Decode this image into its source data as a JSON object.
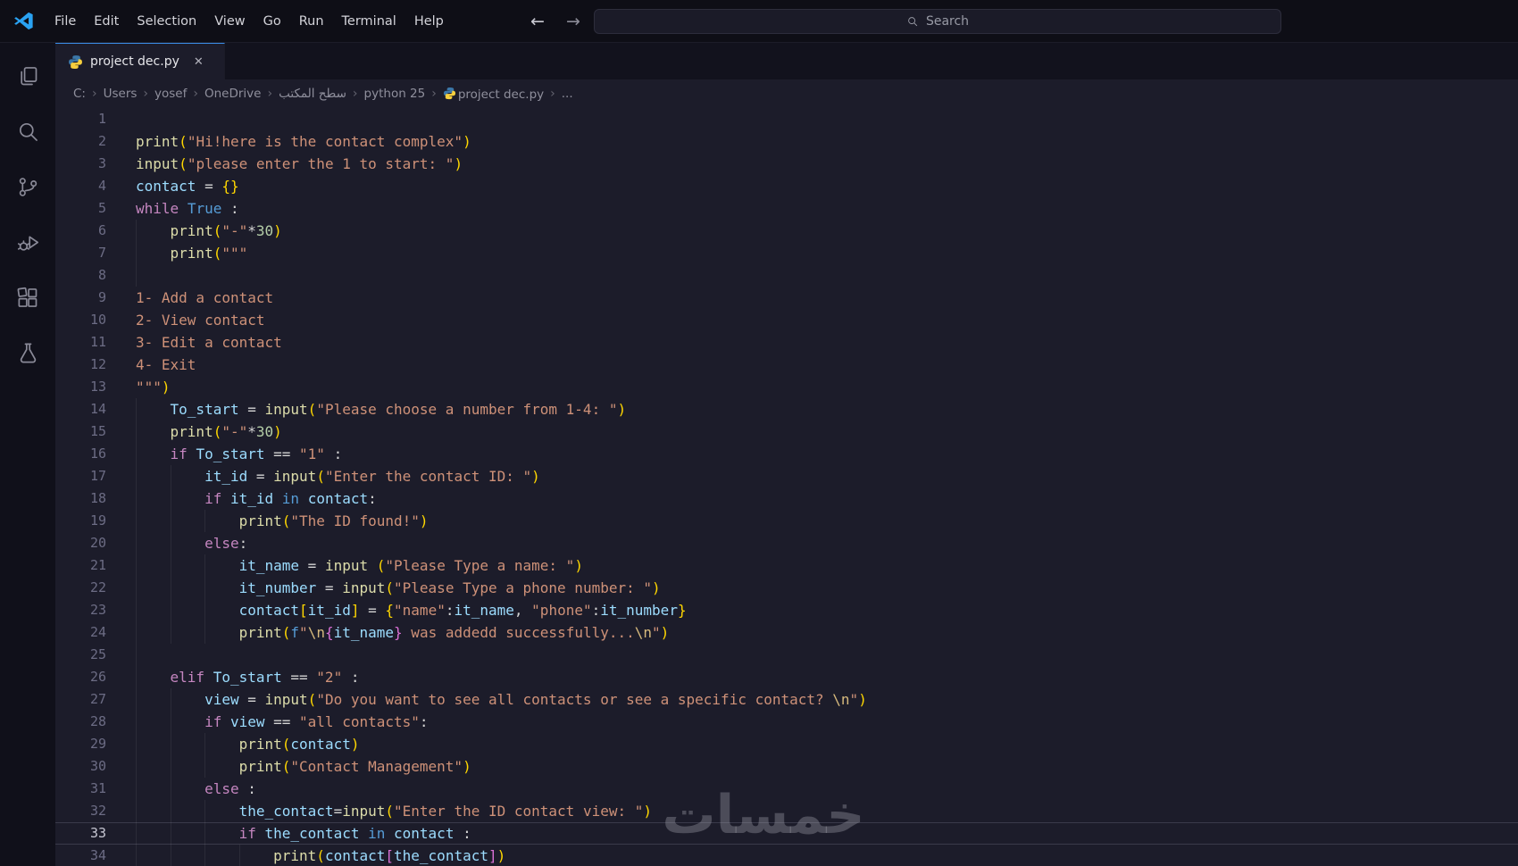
{
  "title_bar": {
    "menus": [
      "File",
      "Edit",
      "Selection",
      "View",
      "Go",
      "Run",
      "Terminal",
      "Help"
    ],
    "search_placeholder": "Search"
  },
  "icons": {
    "back": "←",
    "forward": "→",
    "close": "✕",
    "chevron": "›"
  },
  "colors": {
    "accent": "#3b8eea",
    "python_blue": "#3b77a8",
    "python_yellow": "#f7cf3e",
    "vscode_logo_blue": "#2aa2f2"
  },
  "activity_bar": {
    "items": [
      "explorer",
      "search",
      "source-control",
      "run-and-debug",
      "extensions",
      "testing"
    ]
  },
  "tab": {
    "label": "project dec.py"
  },
  "breadcrumb": {
    "items": [
      {
        "label": "C:"
      },
      {
        "label": "Users"
      },
      {
        "label": "yosef"
      },
      {
        "label": "OneDrive"
      },
      {
        "label": "سطح المكتب"
      },
      {
        "label": "python 25"
      },
      {
        "label": "project dec.py",
        "icon": "python"
      },
      {
        "label": "..."
      }
    ]
  },
  "watermark": {
    "text": "خمسات"
  },
  "syntax_colors": {
    "fn": "#dcdcaa",
    "kw": "#c586c0",
    "kwb": "#569cd6",
    "var": "#9cdcfe",
    "str": "#ce9178",
    "num": "#b5cea8",
    "op": "#d4d4d4",
    "b1": "#ffd700",
    "b2": "#da70d6",
    "esc": "#d7ba7d"
  },
  "editor": {
    "current_line": 33,
    "lines": [
      {
        "n": 1,
        "g": 0,
        "t": []
      },
      {
        "n": 2,
        "g": 0,
        "t": [
          [
            "print",
            "fn"
          ],
          [
            "(",
            "b1"
          ],
          [
            "\"Hi!here is the contact complex\"",
            "str"
          ],
          [
            ")",
            "b1"
          ]
        ]
      },
      {
        "n": 3,
        "g": 0,
        "t": [
          [
            "input",
            "fn"
          ],
          [
            "(",
            "b1"
          ],
          [
            "\"please enter the 1 to start: \"",
            "str"
          ],
          [
            ")",
            "b1"
          ]
        ]
      },
      {
        "n": 4,
        "g": 0,
        "t": [
          [
            "contact",
            "var"
          ],
          [
            " = ",
            "op"
          ],
          [
            "{}",
            "b1"
          ]
        ]
      },
      {
        "n": 5,
        "g": 0,
        "t": [
          [
            "while",
            "kw"
          ],
          [
            " ",
            "op"
          ],
          [
            "True",
            "kwb"
          ],
          [
            " :",
            "op"
          ]
        ]
      },
      {
        "n": 6,
        "g": 1,
        "t": [
          [
            "    ",
            "op"
          ],
          [
            "print",
            "fn"
          ],
          [
            "(",
            "b1"
          ],
          [
            "\"-\"",
            "str"
          ],
          [
            "*",
            "op"
          ],
          [
            "30",
            "num"
          ],
          [
            ")",
            "b1"
          ]
        ]
      },
      {
        "n": 7,
        "g": 1,
        "t": [
          [
            "    ",
            "op"
          ],
          [
            "print",
            "fn"
          ],
          [
            "(",
            "b1"
          ],
          [
            "\"\"\"",
            "str"
          ]
        ]
      },
      {
        "n": 8,
        "g": 1,
        "t": []
      },
      {
        "n": 9,
        "g": 0,
        "t": [
          [
            "1- Add a contact",
            "str"
          ]
        ]
      },
      {
        "n": 10,
        "g": 0,
        "t": [
          [
            "2- View contact",
            "str"
          ]
        ]
      },
      {
        "n": 11,
        "g": 0,
        "t": [
          [
            "3- Edit a contact",
            "str"
          ]
        ]
      },
      {
        "n": 12,
        "g": 0,
        "t": [
          [
            "4- Exit",
            "str"
          ]
        ]
      },
      {
        "n": 13,
        "g": 0,
        "t": [
          [
            "\"\"\"",
            "str"
          ],
          [
            ")",
            "b1"
          ]
        ]
      },
      {
        "n": 14,
        "g": 1,
        "t": [
          [
            "    ",
            "op"
          ],
          [
            "To_start",
            "var"
          ],
          [
            " = ",
            "op"
          ],
          [
            "input",
            "fn"
          ],
          [
            "(",
            "b1"
          ],
          [
            "\"Please choose a number from 1-4: \"",
            "str"
          ],
          [
            ")",
            "b1"
          ]
        ]
      },
      {
        "n": 15,
        "g": 1,
        "t": [
          [
            "    ",
            "op"
          ],
          [
            "print",
            "fn"
          ],
          [
            "(",
            "b1"
          ],
          [
            "\"-\"",
            "str"
          ],
          [
            "*",
            "op"
          ],
          [
            "30",
            "num"
          ],
          [
            ")",
            "b1"
          ]
        ]
      },
      {
        "n": 16,
        "g": 1,
        "t": [
          [
            "    ",
            "op"
          ],
          [
            "if",
            "kw"
          ],
          [
            " ",
            "op"
          ],
          [
            "To_start",
            "var"
          ],
          [
            " == ",
            "op"
          ],
          [
            "\"1\"",
            "str"
          ],
          [
            " :",
            "op"
          ]
        ]
      },
      {
        "n": 17,
        "g": 2,
        "t": [
          [
            "        ",
            "op"
          ],
          [
            "it_id",
            "var"
          ],
          [
            " = ",
            "op"
          ],
          [
            "input",
            "fn"
          ],
          [
            "(",
            "b1"
          ],
          [
            "\"Enter the contact ID: \"",
            "str"
          ],
          [
            ")",
            "b1"
          ]
        ]
      },
      {
        "n": 18,
        "g": 2,
        "t": [
          [
            "        ",
            "op"
          ],
          [
            "if",
            "kw"
          ],
          [
            " ",
            "op"
          ],
          [
            "it_id",
            "var"
          ],
          [
            " ",
            "op"
          ],
          [
            "in",
            "kwb"
          ],
          [
            " ",
            "op"
          ],
          [
            "contact",
            "var"
          ],
          [
            ":",
            "op"
          ]
        ]
      },
      {
        "n": 19,
        "g": 3,
        "t": [
          [
            "            ",
            "op"
          ],
          [
            "print",
            "fn"
          ],
          [
            "(",
            "b1"
          ],
          [
            "\"The ID found!\"",
            "str"
          ],
          [
            ")",
            "b1"
          ]
        ]
      },
      {
        "n": 20,
        "g": 2,
        "t": [
          [
            "        ",
            "op"
          ],
          [
            "else",
            "kw"
          ],
          [
            ":",
            "op"
          ]
        ]
      },
      {
        "n": 21,
        "g": 3,
        "t": [
          [
            "            ",
            "op"
          ],
          [
            "it_name",
            "var"
          ],
          [
            " = ",
            "op"
          ],
          [
            "input",
            "fn"
          ],
          [
            " ",
            "op"
          ],
          [
            "(",
            "b1"
          ],
          [
            "\"Please Type a name: \"",
            "str"
          ],
          [
            ")",
            "b1"
          ]
        ]
      },
      {
        "n": 22,
        "g": 3,
        "t": [
          [
            "            ",
            "op"
          ],
          [
            "it_number",
            "var"
          ],
          [
            " = ",
            "op"
          ],
          [
            "input",
            "fn"
          ],
          [
            "(",
            "b1"
          ],
          [
            "\"Please Type a phone number: \"",
            "str"
          ],
          [
            ")",
            "b1"
          ]
        ]
      },
      {
        "n": 23,
        "g": 3,
        "t": [
          [
            "            ",
            "op"
          ],
          [
            "contact",
            "var"
          ],
          [
            "[",
            "b1"
          ],
          [
            "it_id",
            "var"
          ],
          [
            "]",
            "b1"
          ],
          [
            " = ",
            "op"
          ],
          [
            "{",
            "b1"
          ],
          [
            "\"name\"",
            "str"
          ],
          [
            ":",
            "op"
          ],
          [
            "it_name",
            "var"
          ],
          [
            ", ",
            "op"
          ],
          [
            "\"phone\"",
            "str"
          ],
          [
            ":",
            "op"
          ],
          [
            "it_number",
            "var"
          ],
          [
            "}",
            "b1"
          ]
        ]
      },
      {
        "n": 24,
        "g": 3,
        "t": [
          [
            "            ",
            "op"
          ],
          [
            "print",
            "fn"
          ],
          [
            "(",
            "b1"
          ],
          [
            "f",
            "kwb"
          ],
          [
            "\"",
            "str"
          ],
          [
            "\\n",
            "esc"
          ],
          [
            "{",
            "b2"
          ],
          [
            "it_name",
            "var"
          ],
          [
            "}",
            "b2"
          ],
          [
            " was addedd successfully...",
            "str"
          ],
          [
            "\\n",
            "esc"
          ],
          [
            "\"",
            "str"
          ],
          [
            ")",
            "b1"
          ]
        ]
      },
      {
        "n": 25,
        "g": 1,
        "t": []
      },
      {
        "n": 26,
        "g": 1,
        "t": [
          [
            "    ",
            "op"
          ],
          [
            "elif",
            "kw"
          ],
          [
            " ",
            "op"
          ],
          [
            "To_start",
            "var"
          ],
          [
            " == ",
            "op"
          ],
          [
            "\"2\"",
            "str"
          ],
          [
            " :",
            "op"
          ]
        ]
      },
      {
        "n": 27,
        "g": 2,
        "t": [
          [
            "        ",
            "op"
          ],
          [
            "view",
            "var"
          ],
          [
            " = ",
            "op"
          ],
          [
            "input",
            "fn"
          ],
          [
            "(",
            "b1"
          ],
          [
            "\"Do you want to see all contacts or see a specific contact? ",
            "str"
          ],
          [
            "\\n",
            "esc"
          ],
          [
            "\"",
            "str"
          ],
          [
            ")",
            "b1"
          ]
        ]
      },
      {
        "n": 28,
        "g": 2,
        "t": [
          [
            "        ",
            "op"
          ],
          [
            "if",
            "kw"
          ],
          [
            " ",
            "op"
          ],
          [
            "view",
            "var"
          ],
          [
            " == ",
            "op"
          ],
          [
            "\"all contacts\"",
            "str"
          ],
          [
            ":",
            "op"
          ]
        ]
      },
      {
        "n": 29,
        "g": 3,
        "t": [
          [
            "            ",
            "op"
          ],
          [
            "print",
            "fn"
          ],
          [
            "(",
            "b1"
          ],
          [
            "contact",
            "var"
          ],
          [
            ")",
            "b1"
          ]
        ]
      },
      {
        "n": 30,
        "g": 3,
        "t": [
          [
            "            ",
            "op"
          ],
          [
            "print",
            "fn"
          ],
          [
            "(",
            "b1"
          ],
          [
            "\"Contact Management\"",
            "str"
          ],
          [
            ")",
            "b1"
          ]
        ]
      },
      {
        "n": 31,
        "g": 2,
        "t": [
          [
            "        ",
            "op"
          ],
          [
            "else",
            "kw"
          ],
          [
            " :",
            "op"
          ]
        ]
      },
      {
        "n": 32,
        "g": 3,
        "t": [
          [
            "            ",
            "op"
          ],
          [
            "the_contact",
            "var"
          ],
          [
            "=",
            "op"
          ],
          [
            "input",
            "fn"
          ],
          [
            "(",
            "b1"
          ],
          [
            "\"Enter the ID contact view: \"",
            "str"
          ],
          [
            ")",
            "b1"
          ]
        ]
      },
      {
        "n": 33,
        "g": 3,
        "t": [
          [
            "            ",
            "op"
          ],
          [
            "if",
            "kw"
          ],
          [
            " ",
            "op"
          ],
          [
            "the_contact",
            "var"
          ],
          [
            " ",
            "op"
          ],
          [
            "in",
            "kwb"
          ],
          [
            " ",
            "op"
          ],
          [
            "contact",
            "var"
          ],
          [
            " :",
            "op"
          ]
        ]
      },
      {
        "n": 34,
        "g": 4,
        "t": [
          [
            "                ",
            "op"
          ],
          [
            "print",
            "fn"
          ],
          [
            "(",
            "b1"
          ],
          [
            "contact",
            "var"
          ],
          [
            "[",
            "b2"
          ],
          [
            "the_contact",
            "var"
          ],
          [
            "]",
            "b2"
          ],
          [
            ")",
            "b1"
          ]
        ]
      }
    ]
  }
}
